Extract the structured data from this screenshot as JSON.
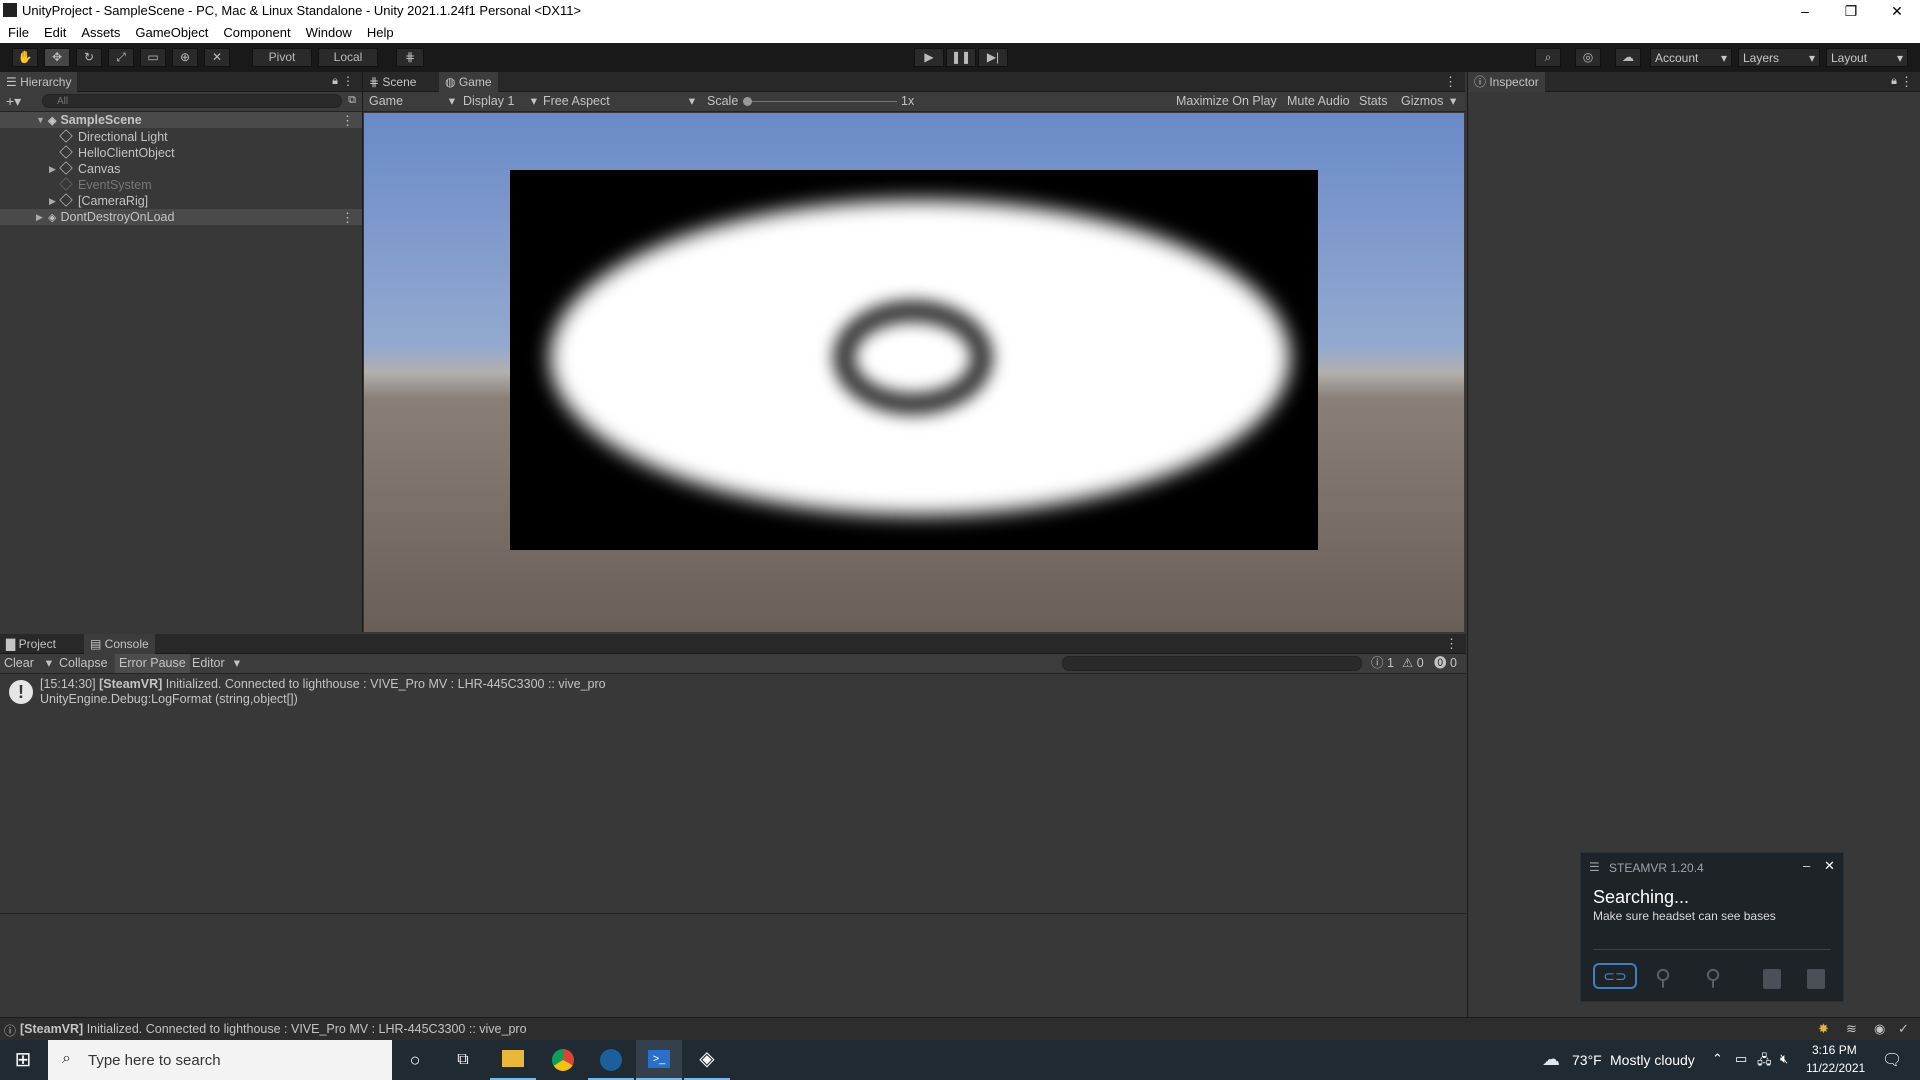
{
  "window": {
    "title": "UnityProject - SampleScene - PC, Mac & Linux Standalone - Unity 2021.1.24f1 Personal <DX11>",
    "minimize": "–",
    "restore": "❐",
    "close": "✕"
  },
  "menu": [
    "File",
    "Edit",
    "Assets",
    "GameObject",
    "Component",
    "Window",
    "Help"
  ],
  "toolbar": {
    "pivot": "Pivot",
    "local": "Local",
    "account": "Account",
    "layers": "Layers",
    "layout": "Layout"
  },
  "hierarchy": {
    "tab": "Hierarchy",
    "search_placeholder": "All",
    "scene": "SampleScene",
    "items": [
      "Directional Light",
      "HelloClientObject",
      "Canvas",
      "EventSystem",
      "[CameraRig]"
    ],
    "ddol": "DontDestroyOnLoad"
  },
  "view_tabs": {
    "scene": "Scene",
    "game": "Game"
  },
  "game_bar": {
    "mode": "Game",
    "display": "Display 1",
    "aspect": "Free Aspect",
    "scale_label": "Scale",
    "scale_value": "1x",
    "maximize": "Maximize On Play",
    "mute": "Mute Audio",
    "stats": "Stats",
    "gizmos": "Gizmos"
  },
  "inspector": {
    "tab": "Inspector"
  },
  "bottom_tabs": {
    "project": "Project",
    "console": "Console"
  },
  "console": {
    "clear": "Clear",
    "collapse": "Collapse",
    "error_pause": "Error Pause",
    "editor": "Editor",
    "count_info": "1",
    "count_warn": "0",
    "count_error": "0",
    "log_time": "[15:14:30]",
    "log_tag": "[SteamVR]",
    "log_msg": " Initialized. Connected to lighthouse : VIVE_Pro MV : LHR-445C3300 :: vive_pro",
    "log_trace": "UnityEngine.Debug:LogFormat (string,object[])"
  },
  "status_bar": {
    "tag": "[SteamVR]",
    "msg": " Initialized. Connected to lighthouse : VIVE_Pro MV : LHR-445C3300 :: vive_pro"
  },
  "steamvr": {
    "header": "STEAMVR 1.20.4",
    "status": "Searching...",
    "hint": "Make sure headset can see bases"
  },
  "taskbar": {
    "search_placeholder": "Type here to search",
    "temp": "73°F",
    "weather": "Mostly cloudy",
    "time": "3:16 PM",
    "date": "11/22/2021"
  }
}
